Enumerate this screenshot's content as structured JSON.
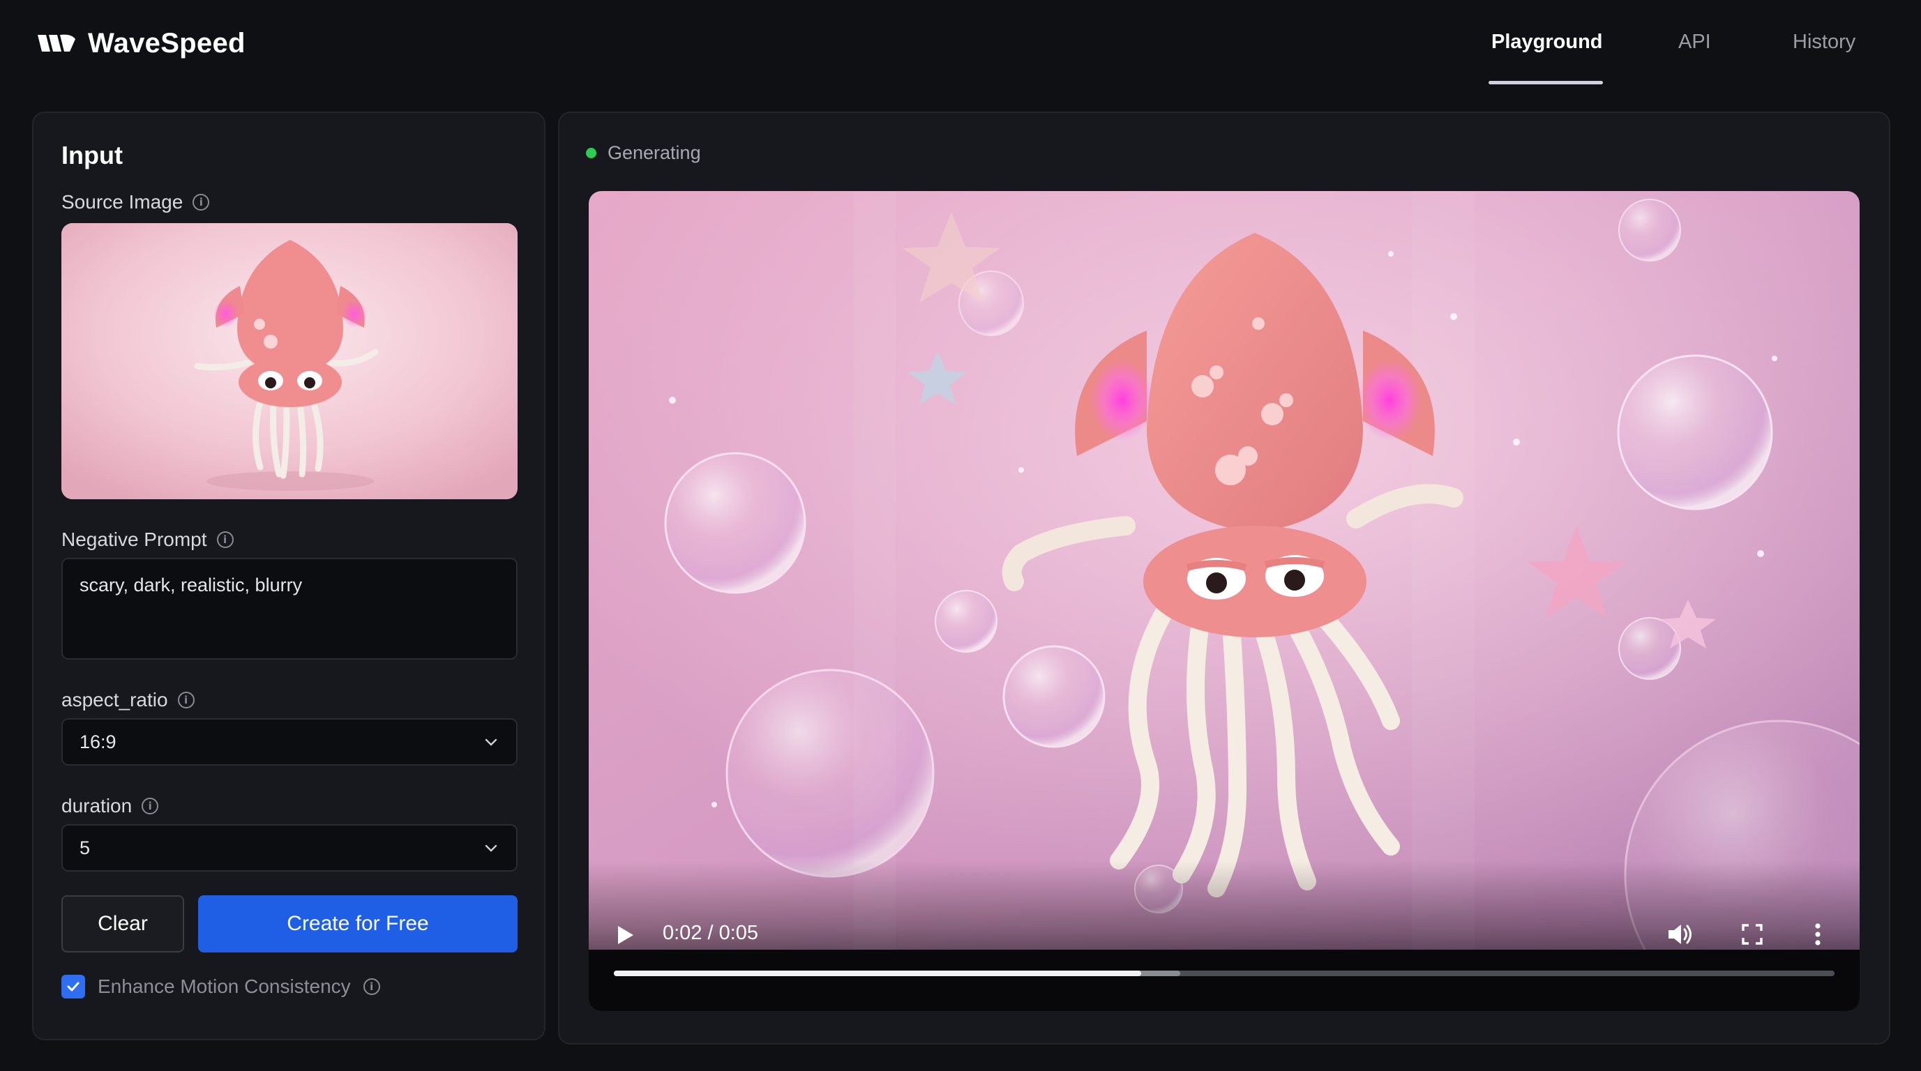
{
  "app": {
    "brand": "WaveSpeed",
    "colors": {
      "accent": "#1f5fe6",
      "status_green": "#2ecc52",
      "background": "#0f1014",
      "panel": "#17181d"
    }
  },
  "nav": {
    "tabs": [
      {
        "label": "Playground",
        "active": true
      },
      {
        "label": "API",
        "active": false
      },
      {
        "label": "History",
        "active": false
      }
    ]
  },
  "input": {
    "title": "Input",
    "source_image": {
      "label": "Source Image",
      "icon": "info-icon"
    },
    "negative_prompt": {
      "label": "Negative Prompt",
      "value": "scary, dark, realistic, blurry"
    },
    "aspect_ratio": {
      "label": "aspect_ratio",
      "value": "16:9"
    },
    "duration": {
      "label": "duration",
      "value": "5"
    },
    "clear_label": "Clear",
    "create_label": "Create for Free",
    "enhance": {
      "label": "Enhance Motion Consistency",
      "checked": true
    }
  },
  "output": {
    "status": "Generating",
    "video": {
      "time": "0:02 / 0:05",
      "played_fraction": 0.432,
      "buffered_fraction": 0.464,
      "icons": [
        "play-icon",
        "volume-icon",
        "fullscreen-icon",
        "more-vert-icon"
      ]
    }
  }
}
